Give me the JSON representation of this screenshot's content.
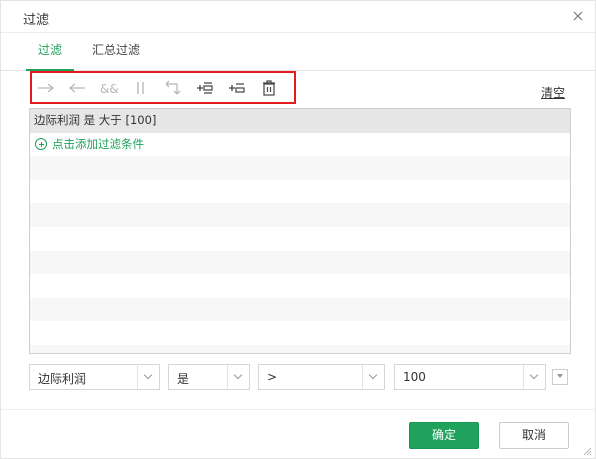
{
  "dialog": {
    "title": "过滤"
  },
  "tabs": [
    {
      "label": "过滤",
      "active": true
    },
    {
      "label": "汇总过滤",
      "active": false
    }
  ],
  "toolbar": {
    "icons": [
      "arrow-right-icon",
      "arrow-left-icon",
      "and-icon",
      "or-icon",
      "swap-icon",
      "insert-before-icon",
      "insert-after-icon",
      "delete-icon"
    ]
  },
  "clear_label": "清空",
  "filter_list": {
    "condition_text": "边际利润 是 大于 [100]",
    "add_label": "点击添加过滤条件"
  },
  "editor": {
    "field": "边际利润",
    "negation": "是",
    "operator": ">",
    "value": "100"
  },
  "buttons": {
    "ok": "确定",
    "cancel": "取消"
  },
  "colors": {
    "accent": "#1fa25b",
    "highlight_border": "#e41b1b"
  }
}
